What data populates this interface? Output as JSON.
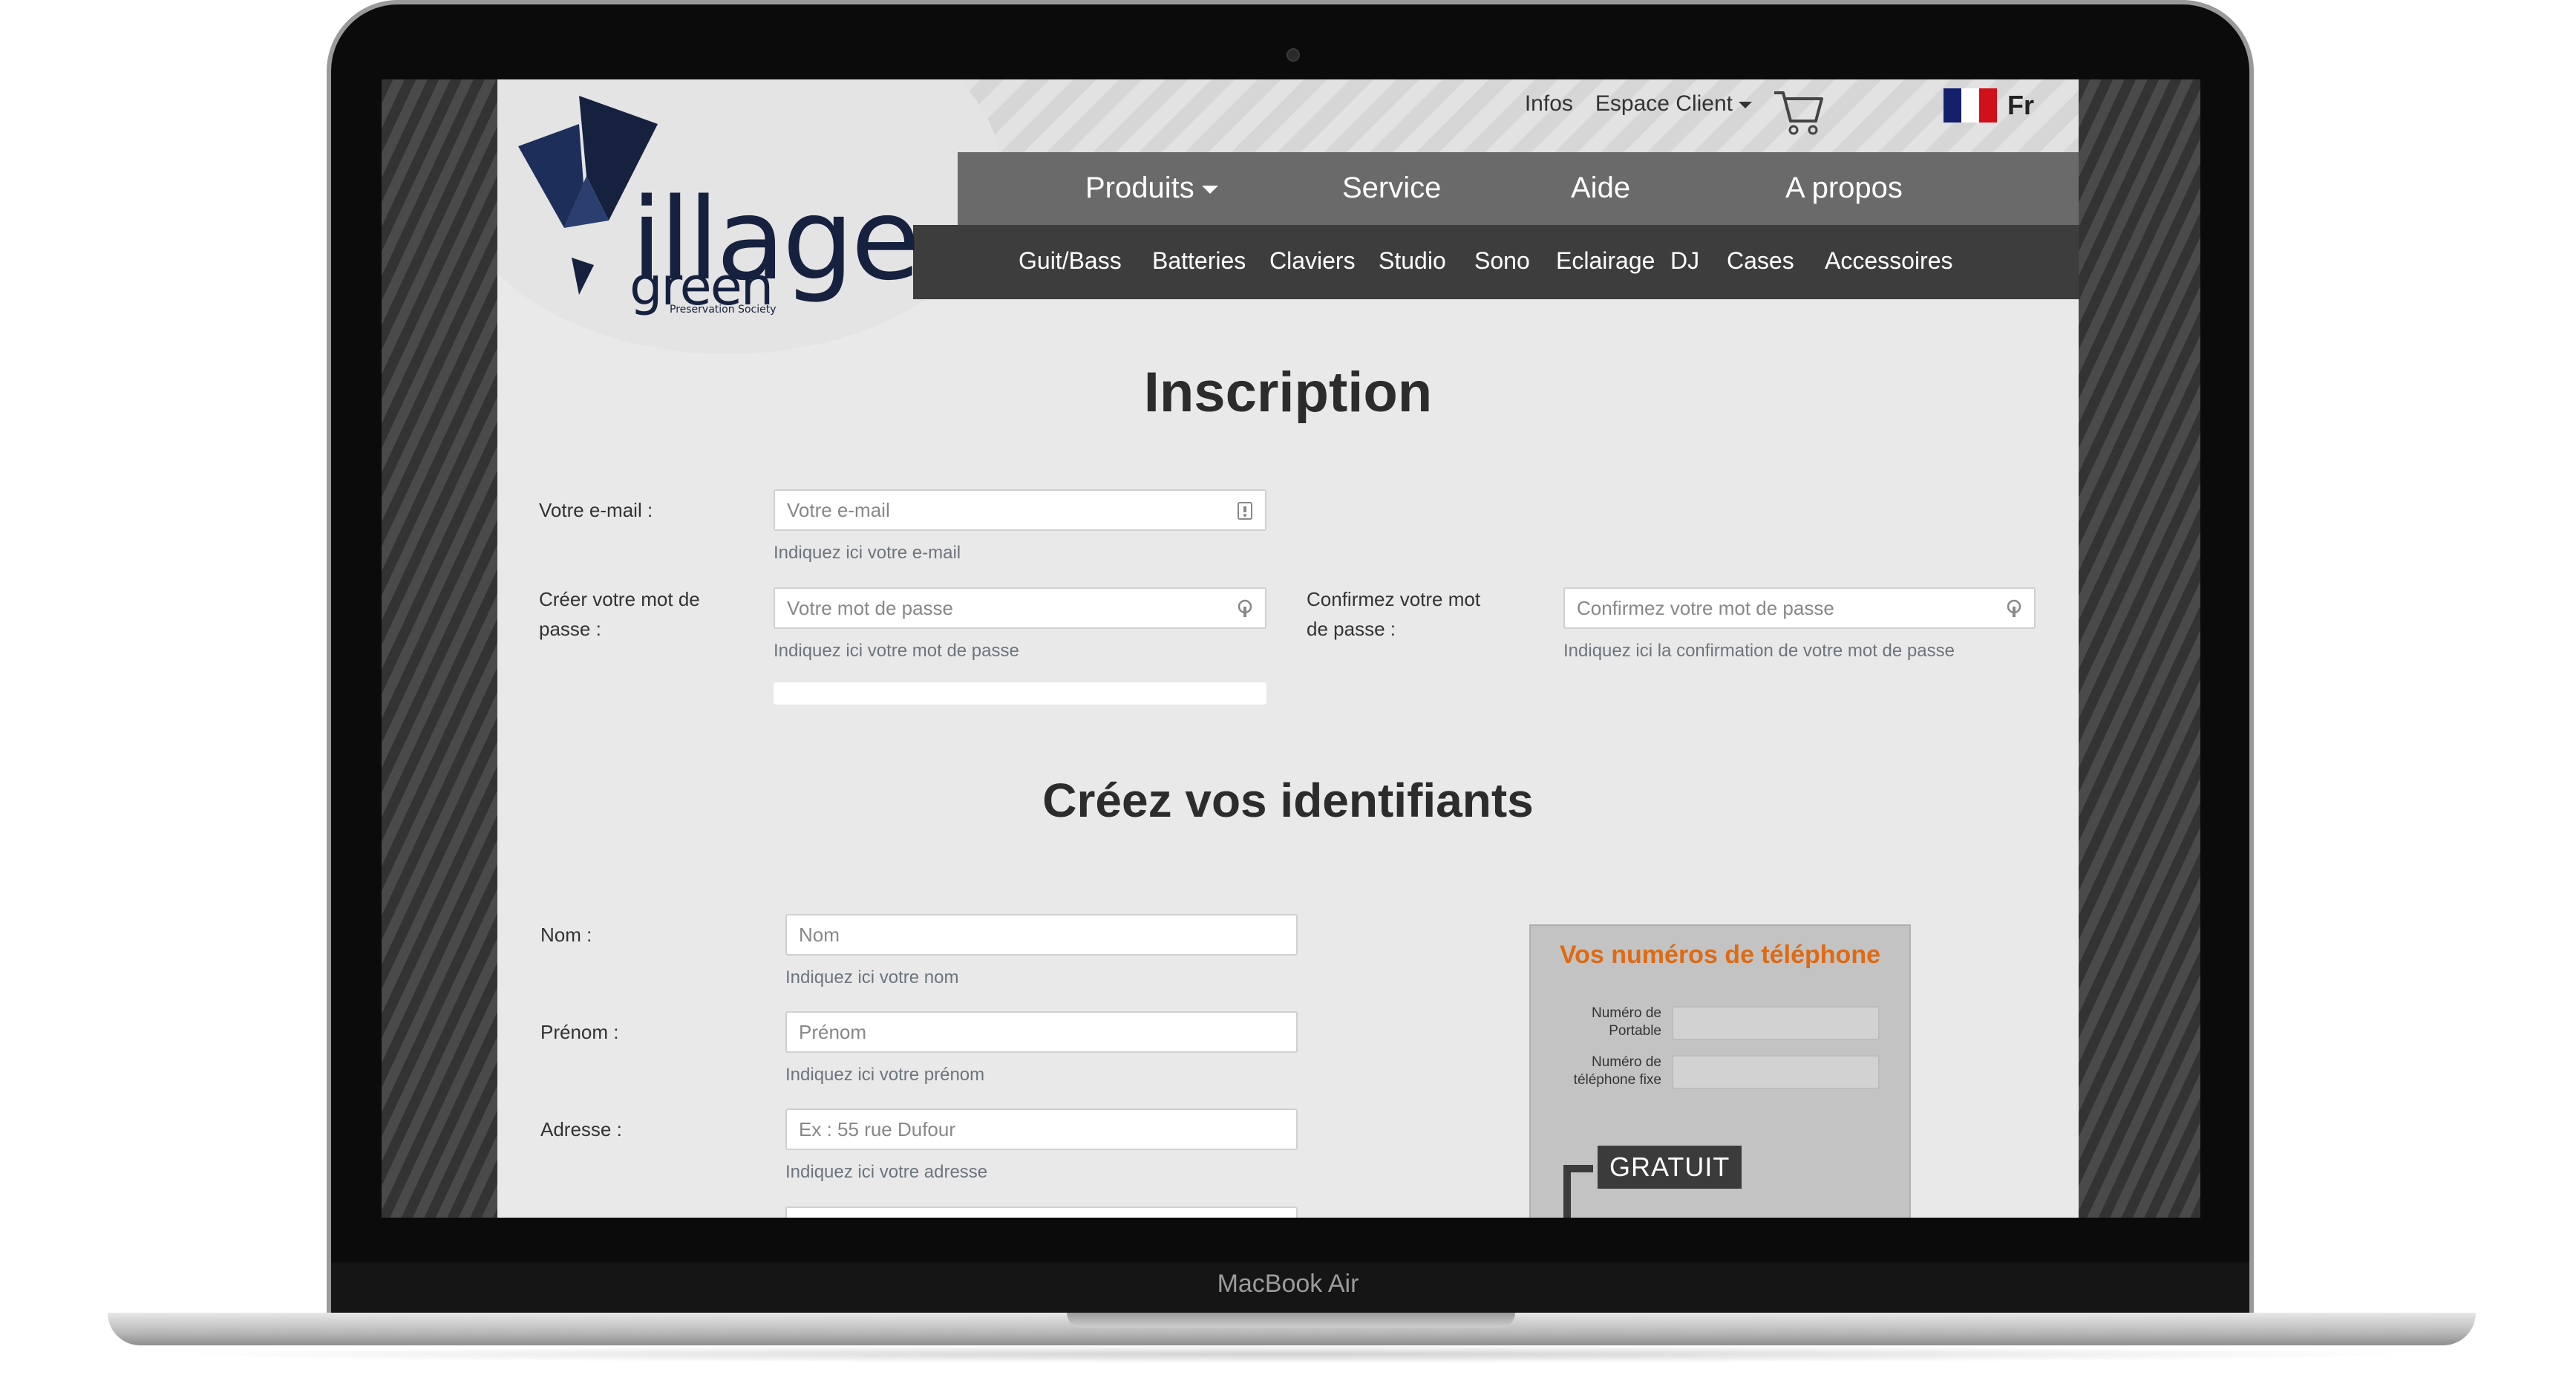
{
  "device": {
    "model_label": "MacBook Air"
  },
  "header": {
    "top_links": {
      "infos": "Infos",
      "client": "Espace Client"
    },
    "language": "Fr",
    "logo": {
      "main": "illage",
      "sub": "green",
      "tagline": "Preservation Society"
    }
  },
  "nav": {
    "main": [
      {
        "label": "Produits"
      },
      {
        "label": "Service"
      },
      {
        "label": "Aide"
      },
      {
        "label": "A propos"
      }
    ],
    "sub": [
      "Guit/Bass",
      "Batteries",
      "Claviers",
      "Studio",
      "Sono",
      "Eclairage",
      "DJ",
      "Cases",
      "Accessoires"
    ]
  },
  "inscription": {
    "title": "Inscription",
    "email": {
      "label": "Votre e-mail :",
      "placeholder": "Votre e-mail",
      "hint": "Indiquez ici votre e-mail"
    },
    "password": {
      "label": "Créer votre mot de passe :",
      "placeholder": "Votre mot de passe",
      "hint": "Indiquez ici votre mot de passe"
    },
    "confirm": {
      "label": "Confirmez votre mot de passe :",
      "placeholder": "Confirmez votre mot de passe",
      "hint": "Indiquez ici la confirmation de votre mot de passe"
    }
  },
  "identifiants": {
    "title": "Créez vos identifiants",
    "nom": {
      "label": "Nom :",
      "placeholder": "Nom",
      "hint": "Indiquez ici votre nom"
    },
    "prenom": {
      "label": "Prénom :",
      "placeholder": "Prénom",
      "hint": "Indiquez ici votre prénom"
    },
    "adresse": {
      "label": "Adresse :",
      "placeholder": "Ex : 55 rue Dufour",
      "hint": "Indiquez ici votre adresse"
    }
  },
  "phone_box": {
    "title": "Vos numéros de téléphone",
    "mobile_label": "Numéro de Portable",
    "fixe_label": "Numéro de téléphone fixe",
    "badge": "GRATUIT"
  },
  "colors": {
    "accent_orange": "#e06a12",
    "nav_dark": "#3d3d3d",
    "nav_mid": "#6a6a6a",
    "logo_navy": "#16213f"
  }
}
